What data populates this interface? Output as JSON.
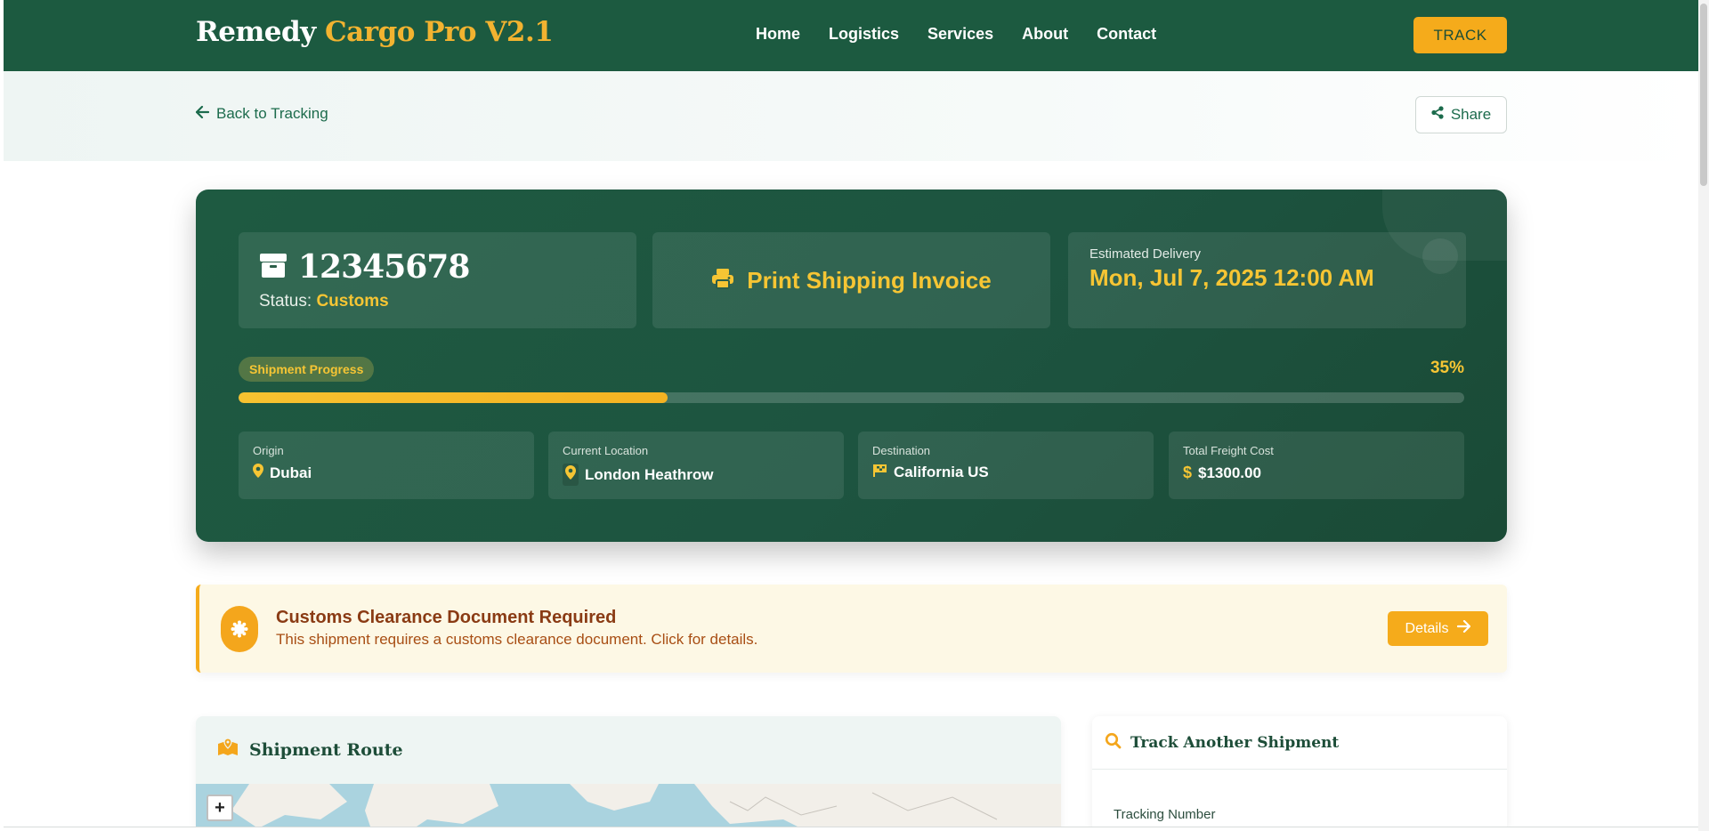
{
  "header": {
    "brand_main": "Remedy",
    "brand_accent": "Cargo Pro V2.1",
    "nav": [
      "Home",
      "Logistics",
      "Services",
      "About",
      "Contact"
    ],
    "track_label": "TRACK"
  },
  "subbar": {
    "back_label": "Back to Tracking",
    "share_label": "Share"
  },
  "shipment": {
    "tracking_number": "12345678",
    "status_label": "Status:",
    "status_value": "Customs",
    "print_label": "Print Shipping Invoice",
    "estimated_label": "Estimated Delivery",
    "estimated_value": "Mon, Jul 7, 2025 12:00 AM",
    "progress_label": "Shipment Progress",
    "progress_text": "35%",
    "progress_value": 35,
    "origin_label": "Origin",
    "origin_value": "Dubai",
    "current_label": "Current Location",
    "current_value": "London Heathrow",
    "destination_label": "Destination",
    "destination_value": "California US",
    "cost_label": "Total Freight Cost",
    "cost_value": "$1300.00"
  },
  "alert": {
    "title": "Customs Clearance Document Required",
    "text": "This shipment requires a customs clearance document. Click for details.",
    "button_label": "Details"
  },
  "route": {
    "title": "Shipment Route",
    "zoom_in": "+"
  },
  "track_another": {
    "title": "Track Another Shipment",
    "field_label": "Tracking Number"
  },
  "colors": {
    "primary": "#1c5a40",
    "accent": "#f5ab1b",
    "highlight": "#f6c534"
  },
  "icons": {
    "back": "arrow-left-icon",
    "share": "share-icon",
    "box": "box-icon",
    "print": "printer-icon",
    "pin": "map-pin-icon",
    "flag": "flag-icon",
    "dollar": "dollar-icon",
    "badge": "certificate-icon",
    "details": "arrow-right-icon",
    "map": "map-icon",
    "search": "search-icon"
  }
}
